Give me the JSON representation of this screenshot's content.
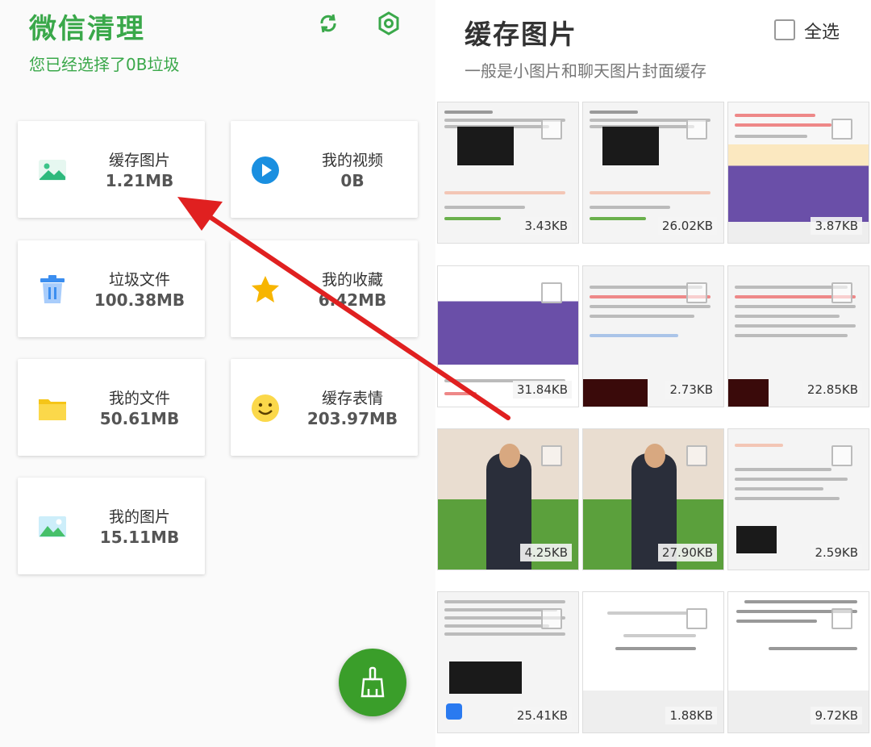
{
  "left": {
    "title": "微信清理",
    "subtitle": "您已经选择了0B垃圾",
    "cards": [
      {
        "label": "缓存图片",
        "size": "1.21MB",
        "icon": "image-icon"
      },
      {
        "label": "我的视频",
        "size": "0B",
        "icon": "play-icon"
      },
      {
        "label": "垃圾文件",
        "size": "100.38MB",
        "icon": "trash-icon"
      },
      {
        "label": "我的收藏",
        "size": "6.42MB",
        "icon": "star-icon"
      },
      {
        "label": "我的文件",
        "size": "50.61MB",
        "icon": "folder-icon"
      },
      {
        "label": "缓存表情",
        "size": "203.97MB",
        "icon": "smile-icon"
      },
      {
        "label": "我的图片",
        "size": "15.11MB",
        "icon": "picture-icon"
      }
    ]
  },
  "right": {
    "title": "缓存图片",
    "subtitle": "一般是小图片和聊天图片封面缓存",
    "select_all": "全选",
    "thumbs": [
      {
        "size": "3.43KB"
      },
      {
        "size": "26.02KB"
      },
      {
        "size": "3.87KB"
      },
      {
        "size": "31.84KB"
      },
      {
        "size": "2.73KB"
      },
      {
        "size": "22.85KB"
      },
      {
        "size": "4.25KB"
      },
      {
        "size": "27.90KB"
      },
      {
        "size": "2.59KB"
      },
      {
        "size": "25.41KB"
      },
      {
        "size": "1.88KB"
      },
      {
        "size": "9.72KB"
      }
    ]
  },
  "colors": {
    "brand": "#3aa84a",
    "fab": "#3a9e2a",
    "arrow": "#e02020"
  }
}
